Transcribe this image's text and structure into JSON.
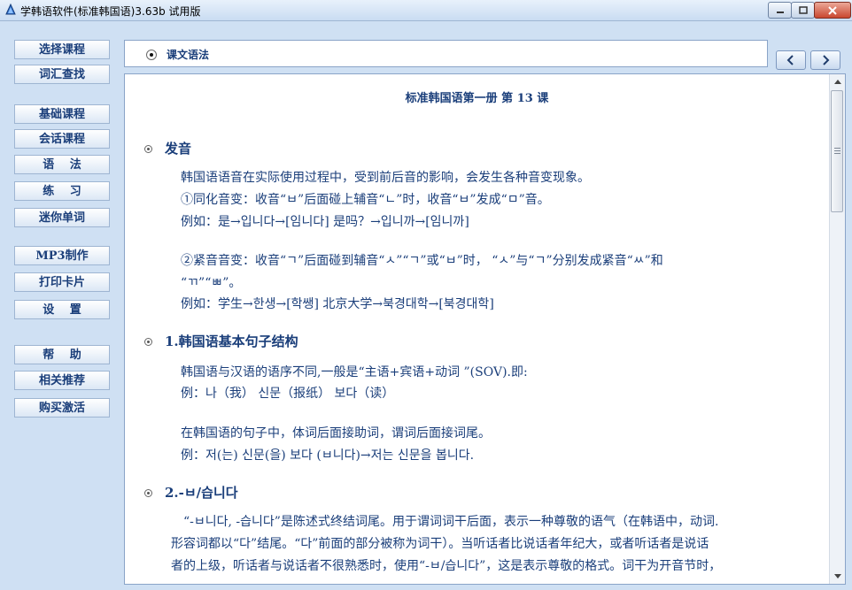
{
  "window": {
    "title": "学韩语软件(标准韩国语)3.63b 试用版",
    "minimize_icon": "minimize-icon",
    "maximize_icon": "maximize-icon",
    "close_icon": "close-icon"
  },
  "sidebar": {
    "groups": [
      {
        "items": [
          "选择课程",
          "词汇查找"
        ]
      },
      {
        "items": [
          "基础课程",
          "会话课程",
          "语　 法",
          "练　 习",
          "迷你单词"
        ]
      },
      {
        "items": [
          "MP3制作",
          "打印卡片",
          "设　 置"
        ]
      },
      {
        "items": [
          "帮　 助",
          "相关推荐",
          "购买激活"
        ]
      }
    ]
  },
  "header": {
    "selected_option": "课文语法",
    "prev_icon": "chevron-left-icon",
    "next_icon": "chevron-right-icon"
  },
  "content": {
    "lesson_title": "标准韩国语第一册  第  13  课",
    "sections": [
      {
        "title": "发音",
        "lines": [
          "韩国语语音在实际使用过程中，受到前后音的影响，会发生各种音变现象。",
          "①同化音变：收音“ㅂ”后面碰上辅音“ㄴ”时，收音“ㅂ”发成“ㅁ”音。",
          "例如：是→입니다→[임니다]    是吗？→입니까→[임니까]",
          "",
          "②紧音音变：收音“ㄱ”后面碰到辅音“ㅅ”“ㄱ”或“ㅂ”时，  “ㅅ”与“ㄱ”分别发成紧音“ㅆ”和",
          "“ㄲ”“ㅃ”。",
          "例如：学生→한생→[학쌩]   北京大学→북경대학→[북경대학]"
        ]
      },
      {
        "title": "1.韩国语基本句子结构",
        "lines": [
          "韩国语与汉语的语序不同,一般是“主语+宾语+动词 ”(SOV).即:",
          "例：나（我）  신문（报纸）  보다（读）",
          "",
          "在韩国语的句子中，体词后面接助词，谓词后面接词尾。",
          "例：저(는) 신문(을) 보다 (ㅂ니다)→저는 신문을 봅니다."
        ]
      },
      {
        "title": "2.-ㅂ/습니다",
        "lines": [
          "“-ㅂ니다, -습니다”是陈述式终结词尾。用于谓词词干后面，表示一种尊敬的语气（在韩语中，动词.",
          "形容词都以“다”结尾。“다”前面的部分被称为词干）。当听话者比说话者年纪大，或者听话者是说话",
          "者的上级，听话者与说话者不很熟悉时，使用“-ㅂ/습니다”，这是表示尊敬的格式。词干为开音节时，"
        ]
      }
    ]
  },
  "colors": {
    "text": "#1a3e7a",
    "background": "#cfe0f3",
    "panel": "#ffffff",
    "border": "#8aa4c8"
  }
}
